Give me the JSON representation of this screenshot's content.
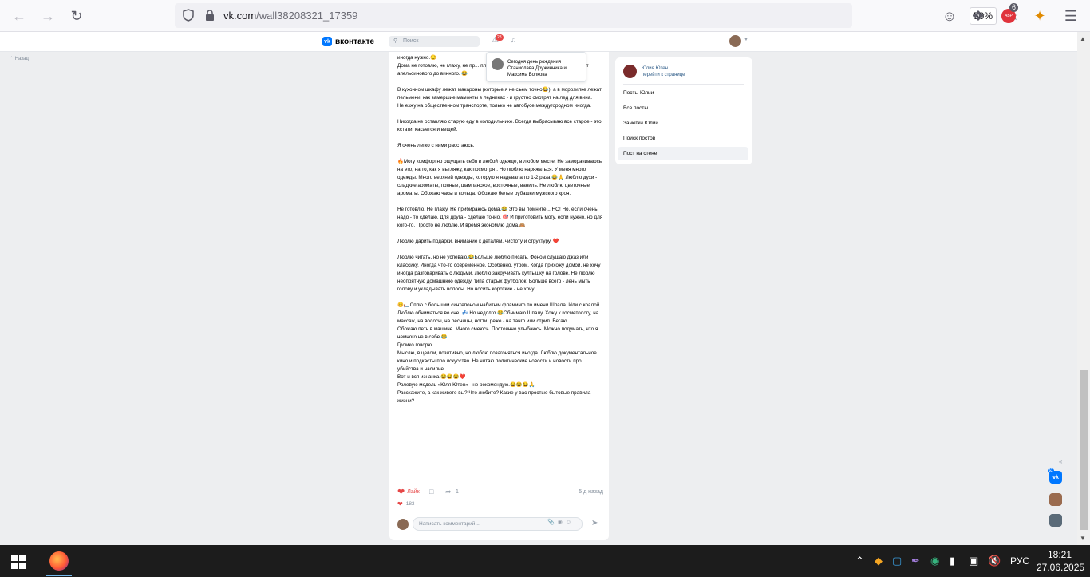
{
  "browser": {
    "url_domain": "vk.com",
    "url_path": "/wall38208321_17359",
    "zoom": "50%",
    "ext_badge_count": "6",
    "abp_label": "АВР"
  },
  "vk": {
    "logo_text": "вконтакте",
    "search_placeholder": "Поиск",
    "notifications_count": "28",
    "back_link": "Назад"
  },
  "notification": {
    "text": "Сегодня день рождения Станислава Дружинника и Максима Волкова"
  },
  "post": {
    "paragraphs": [
      {
        "text": "иногда нужно.😏",
        "gap": false
      },
      {
        "text": "Дома не готовлю, не глажу, не пр... плита.😂 На случай особого траш... шкафу, от апельсинового до винного. 😂",
        "gap": false
      },
      {
        "text": "В кухонном шкафу лежат макароны (которые я не съем точно😂), а в морозилке лежат пельмени, как замершие мамонты в ледниках - и грустно смотрят на лед для вина.",
        "gap": true
      },
      {
        "text": "Не езжу на общественном транспорте, только не автобусе междугородном иногда.",
        "gap": false
      },
      {
        "text": "Никогда не оставляю старую еду в холодильнике. Всегда выбрасываю все старое - это, кстати, касается и вещей.",
        "gap": true
      },
      {
        "text": "Я очень легко с ними расстаюсь.",
        "gap": true
      },
      {
        "text": "🔥Могу комфортно ощущать себя в любой одежде, в любом месте. Не заморачиваюсь на это, на то, как я выгляжу, как посмотрят. Но люблю наряжаться. У меня много одежды. Много верхней одежды, которую я надевала по 1-2 раза.😂🙏 Люблю духи - сладкие ароматы, пряные, шампанское, восточные, ваниль. Не люблю цветочные ароматы. Обожаю часы и кольца. Обожаю белые рубашки мужского кроя.",
        "gap": true
      },
      {
        "text": "Не готовлю. Не глажу. Не прибираюсь дома.😂 Это вы помните... НО! Но, если очень надо - то сделаю. Для друга - сделаю точно. 🎯 И приготовить могу, если нужно, но для кого-то. Просто не люблю. И время экономлю дома.🙈",
        "gap": true
      },
      {
        "text": "Люблю дарить подарки, внимание к деталям, чистоту и структуру. ❤️",
        "gap": true
      },
      {
        "text": "Люблю читать, но не успеваю.😂Больше люблю писать. Фоном слушаю джаз или классику. Иногда что-то современное. Особенно, утром. Когда прихожу домой, не хочу иногда разговаривать с людьми. Люблю закручивать култышку на голове. Не люблю неопрятную домашнюю одежду, типа старых футболок. Больше всего - лень мыть голову и укладывать волосы. Но носить короткие - не хочу.",
        "gap": true
      },
      {
        "text": "😊🛏️Сплю с большим синтепоном набитым фламинго по имени Шпала. Или с коалой. Люблю обниматься во сне. 💤 Но недолго.😂Обнимаю Шпалу. Хожу к косметологу, на массаж, на волосы, на ресницы, ногти, реже - на танго или стрип. Бегаю.",
        "gap": true
      },
      {
        "text": "Обожаю петь в машине. Много смеюсь. Постоянно улыбаюсь. Можно подумать, что я немного не в себе.😂",
        "gap": false
      },
      {
        "text": "Громко говорю.",
        "gap": false
      },
      {
        "text": "Мыслю, в целом, позитивно, но люблю позагоняться иногда. Люблю документальное кино и подкасты про искусство. Не читаю политические новости и новости про убийства и насилие.",
        "gap": false
      },
      {
        "text": "Вот и вся изнанка.😂😂😂❤️",
        "gap": false
      },
      {
        "text": "Ролевую модель «Юля Ютен» - не рекомендую.😂😂😂🙏",
        "gap": false
      },
      {
        "text": "Расскажите, а как живете вы? Что любите? Какие у вас простые бытовые правила жизни?",
        "gap": false
      }
    ],
    "like_label": "Лайк",
    "share_count": "1",
    "time": "5 д назад",
    "likes_count": "183",
    "comment_placeholder": "Написать комментарий..."
  },
  "sidebar": {
    "owner_name": "Юлия Ютен",
    "owner_link": "перейти к странице",
    "menu": [
      {
        "label": "Посты Юлии",
        "active": false
      },
      {
        "label": "Все посты",
        "active": false
      },
      {
        "label": "Заметки Юлии",
        "active": false
      },
      {
        "label": "Поиск постов",
        "active": false
      },
      {
        "label": "Пост на стене",
        "active": true
      }
    ]
  },
  "chat_widget": {
    "vk_badge": "61"
  },
  "taskbar": {
    "lang": "РУС",
    "time": "18:21",
    "date": "27.06.2025"
  }
}
